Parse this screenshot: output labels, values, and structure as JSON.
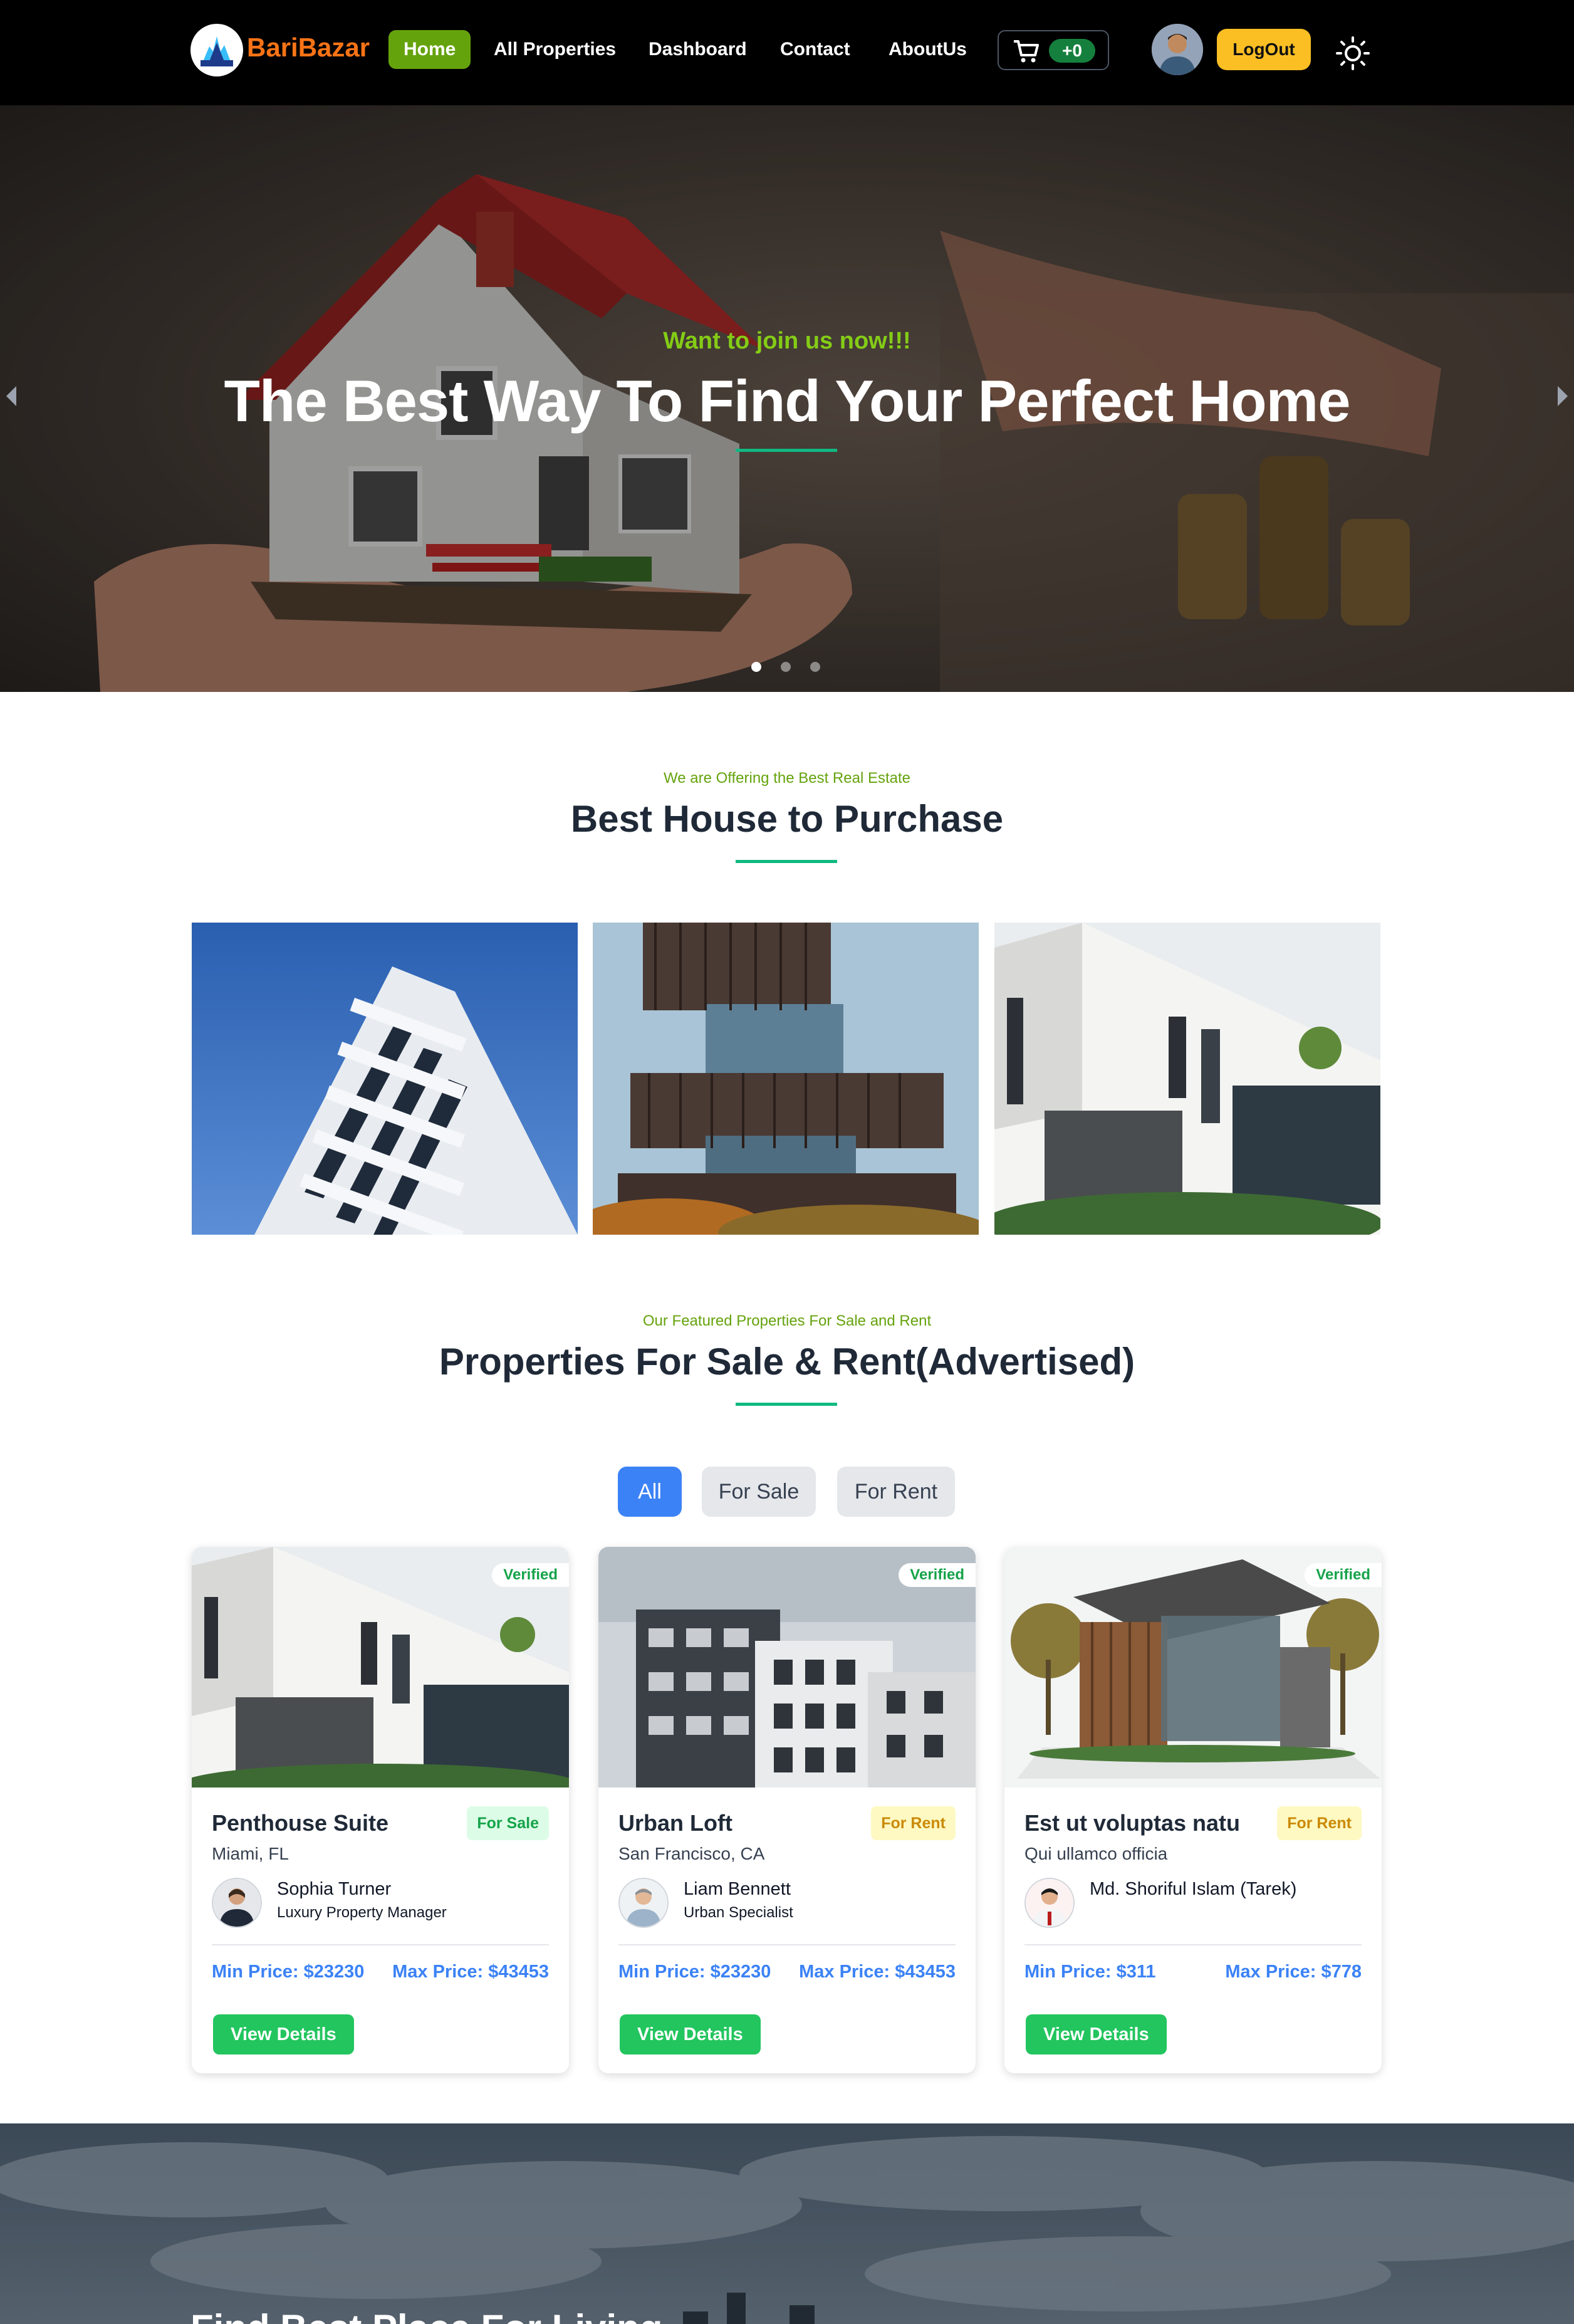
{
  "brand": {
    "name": "BariBazar",
    "logo_text": "BARIBAZAR"
  },
  "nav": {
    "items": [
      {
        "label": "Home",
        "active": true
      },
      {
        "label": "All Properties"
      },
      {
        "label": "Dashboard"
      },
      {
        "label": "Contact"
      },
      {
        "label": "AboutUs"
      }
    ],
    "cart_count": "+0",
    "cart_icon": "cart-icon",
    "logout_label": "LogOut",
    "theme_icon": "sun-icon"
  },
  "hero": {
    "subtitle": "Want to join us now!!!",
    "title": "The Best Way To Find Your Perfect Home",
    "slide_count": 3,
    "active_slide": 1
  },
  "best_houses": {
    "small": "We are Offering the Best Real Estate",
    "title": "Best House to Purchase"
  },
  "featured": {
    "small": "Our Featured Properties For Sale and Rent",
    "title": "Properties For Sale & Rent(Advertised)",
    "filters": [
      "All",
      "For Sale",
      "For Rent"
    ],
    "active_filter": "All",
    "cards": [
      {
        "verified": "Verified",
        "title": "Penthouse Suite",
        "status": "For Sale",
        "location": "Miami, FL",
        "agent_name": "Sophia Turner",
        "agent_role": "Luxury Property Manager",
        "min_price": "Min Price: $23230",
        "max_price": "Max Price: $43453",
        "button": "View Details"
      },
      {
        "verified": "Verified",
        "title": "Urban Loft",
        "status": "For Rent",
        "location": "San Francisco, CA",
        "agent_name": "Liam Bennett",
        "agent_role": "Urban Specialist",
        "min_price": "Min Price: $23230",
        "max_price": "Max Price: $43453",
        "button": "View Details"
      },
      {
        "verified": "Verified",
        "title": "Est ut voluptas natu",
        "status": "For Rent",
        "location": "Qui ullamco officia",
        "agent_name": "Md. Shoriful Islam (Tarek)",
        "agent_role": "",
        "min_price": "Min Price: $311",
        "max_price": "Max Price: $778",
        "button": "View Details"
      }
    ]
  },
  "bottom_banner": {
    "title": "Find Best Place For Living"
  },
  "colors": {
    "brand": "#f97316",
    "nav_active": "#65a30d",
    "logout": "#fbbf24",
    "accent_line": "#10b981",
    "subtitle_green": "#84cc16",
    "filter_active": "#3b82f6",
    "price": "#3b82f6",
    "view_button": "#22c55e"
  }
}
